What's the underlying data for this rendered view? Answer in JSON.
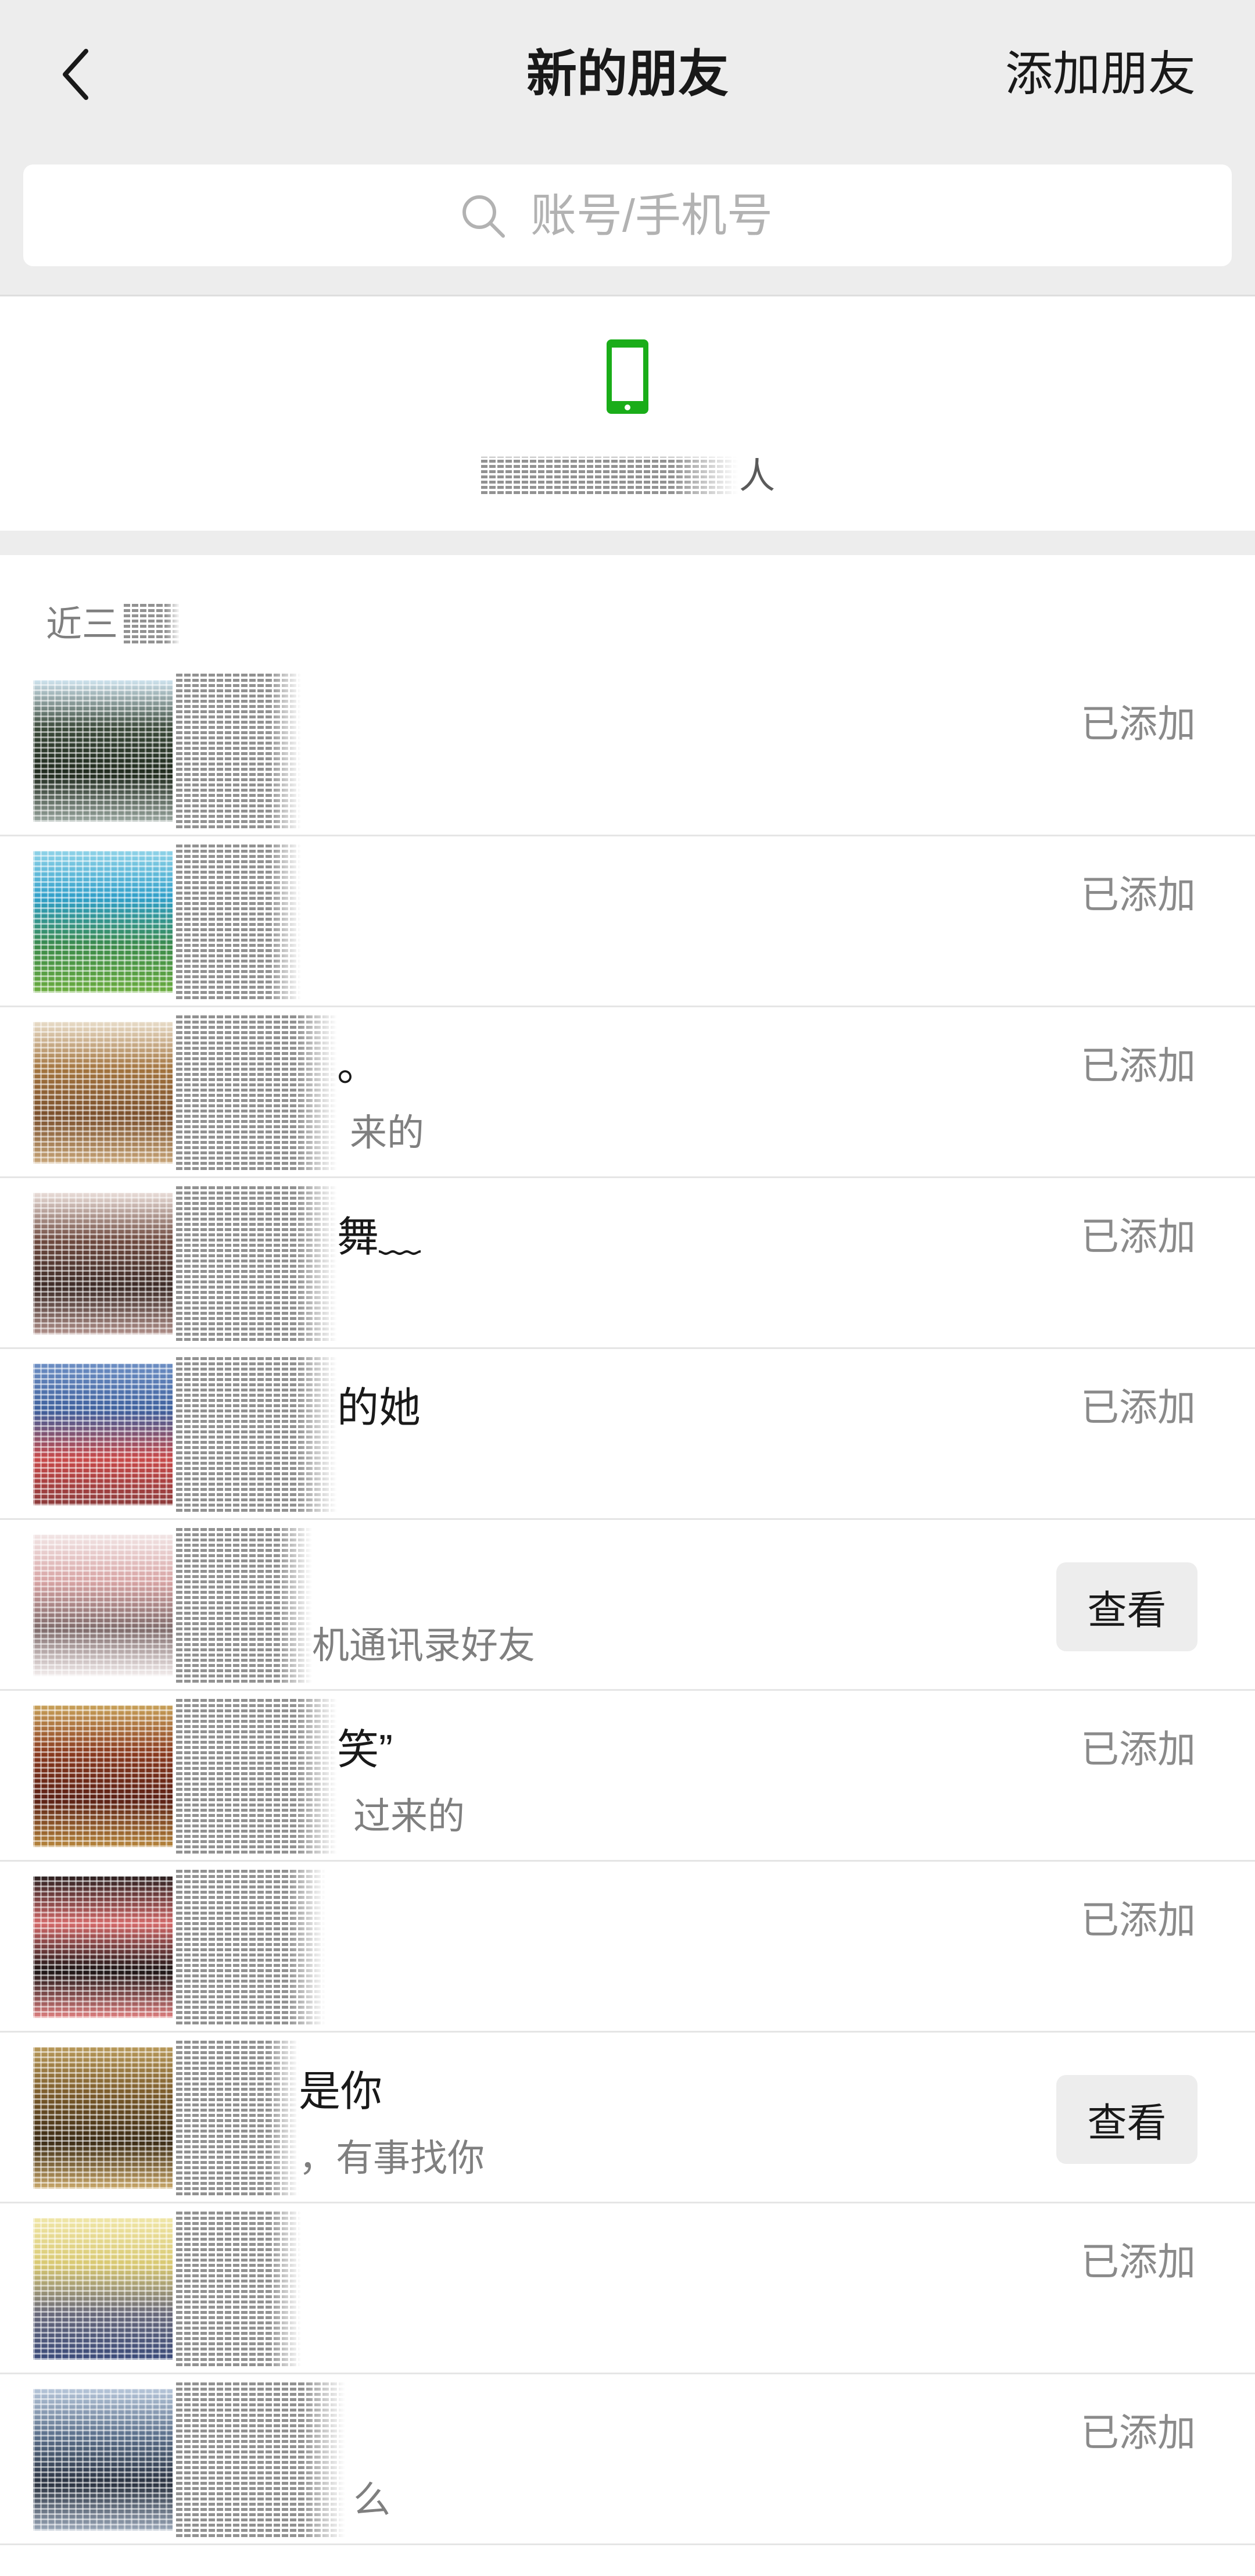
{
  "header": {
    "title": "新的朋友",
    "add_friend_label": "添加朋友",
    "back_icon": "chevron-left-icon"
  },
  "search": {
    "placeholder": "账号/手机号",
    "icon": "search-icon"
  },
  "phone_contacts": {
    "icon": "phone-icon",
    "label_tail": "人"
  },
  "section": {
    "header": "近三"
  },
  "colors": {
    "accent_green": "#1aad19",
    "header_bg": "#ededed",
    "secondary_text": "#8a8a8a"
  },
  "rows": [
    {
      "action_label": "已添加",
      "avatar_colors": [
        "#cfe4ef",
        "#3b4a3a",
        "#1f2a1d",
        "#9aa7a0"
      ]
    },
    {
      "action_label": "已添加",
      "avatar_colors": [
        "#8fd3e8",
        "#2f9fc9",
        "#3a8a4a",
        "#6cae3f"
      ]
    },
    {
      "name_tail": "。",
      "subtitle_tail": "来的",
      "action_label": "已添加",
      "avatar_colors": [
        "#e8dcc8",
        "#a3743e",
        "#7a4f2c",
        "#c9a77a"
      ]
    },
    {
      "name_tail": "舞﹏",
      "action_label": "已添加",
      "avatar_colors": [
        "#e9ddd8",
        "#6f4a3f",
        "#3b2a26",
        "#b0908a"
      ]
    },
    {
      "name_tail": "的她",
      "action_label": "已添加",
      "avatar_colors": [
        "#6d8fc4",
        "#3d5f9c",
        "#c94a4a",
        "#8b3a3a"
      ]
    },
    {
      "subtitle_tail": "机通讯录好友",
      "action_label": "查看",
      "avatar_colors": [
        "#f2e6e6",
        "#d7a3a3",
        "#7e6a6a",
        "#f4eeee"
      ]
    },
    {
      "name_tail": "笑”",
      "subtitle_tail": "过来的",
      "action_label": "已添加",
      "avatar_colors": [
        "#c9a25a",
        "#8a3a1f",
        "#5a1f14",
        "#b7863c"
      ]
    },
    {
      "action_label": "已添加",
      "avatar_colors": [
        "#2a1f1f",
        "#d46a6a",
        "#1a1414",
        "#e08080"
      ]
    },
    {
      "name_tail": "是你",
      "subtitle_tail": "，有事找你",
      "action_label": "查看",
      "avatar_colors": [
        "#b8995a",
        "#7a5a2a",
        "#3a2a14",
        "#caa86a"
      ]
    },
    {
      "action_label": "已添加",
      "avatar_colors": [
        "#f0e6a8",
        "#d8c870",
        "#6a6a7a",
        "#3a4a7a"
      ]
    },
    {
      "subtitle_tail": "么",
      "action_label": "已添加",
      "avatar_colors": [
        "#b7c7da",
        "#5a6f8a",
        "#2a3240",
        "#9aa7b8"
      ]
    }
  ]
}
